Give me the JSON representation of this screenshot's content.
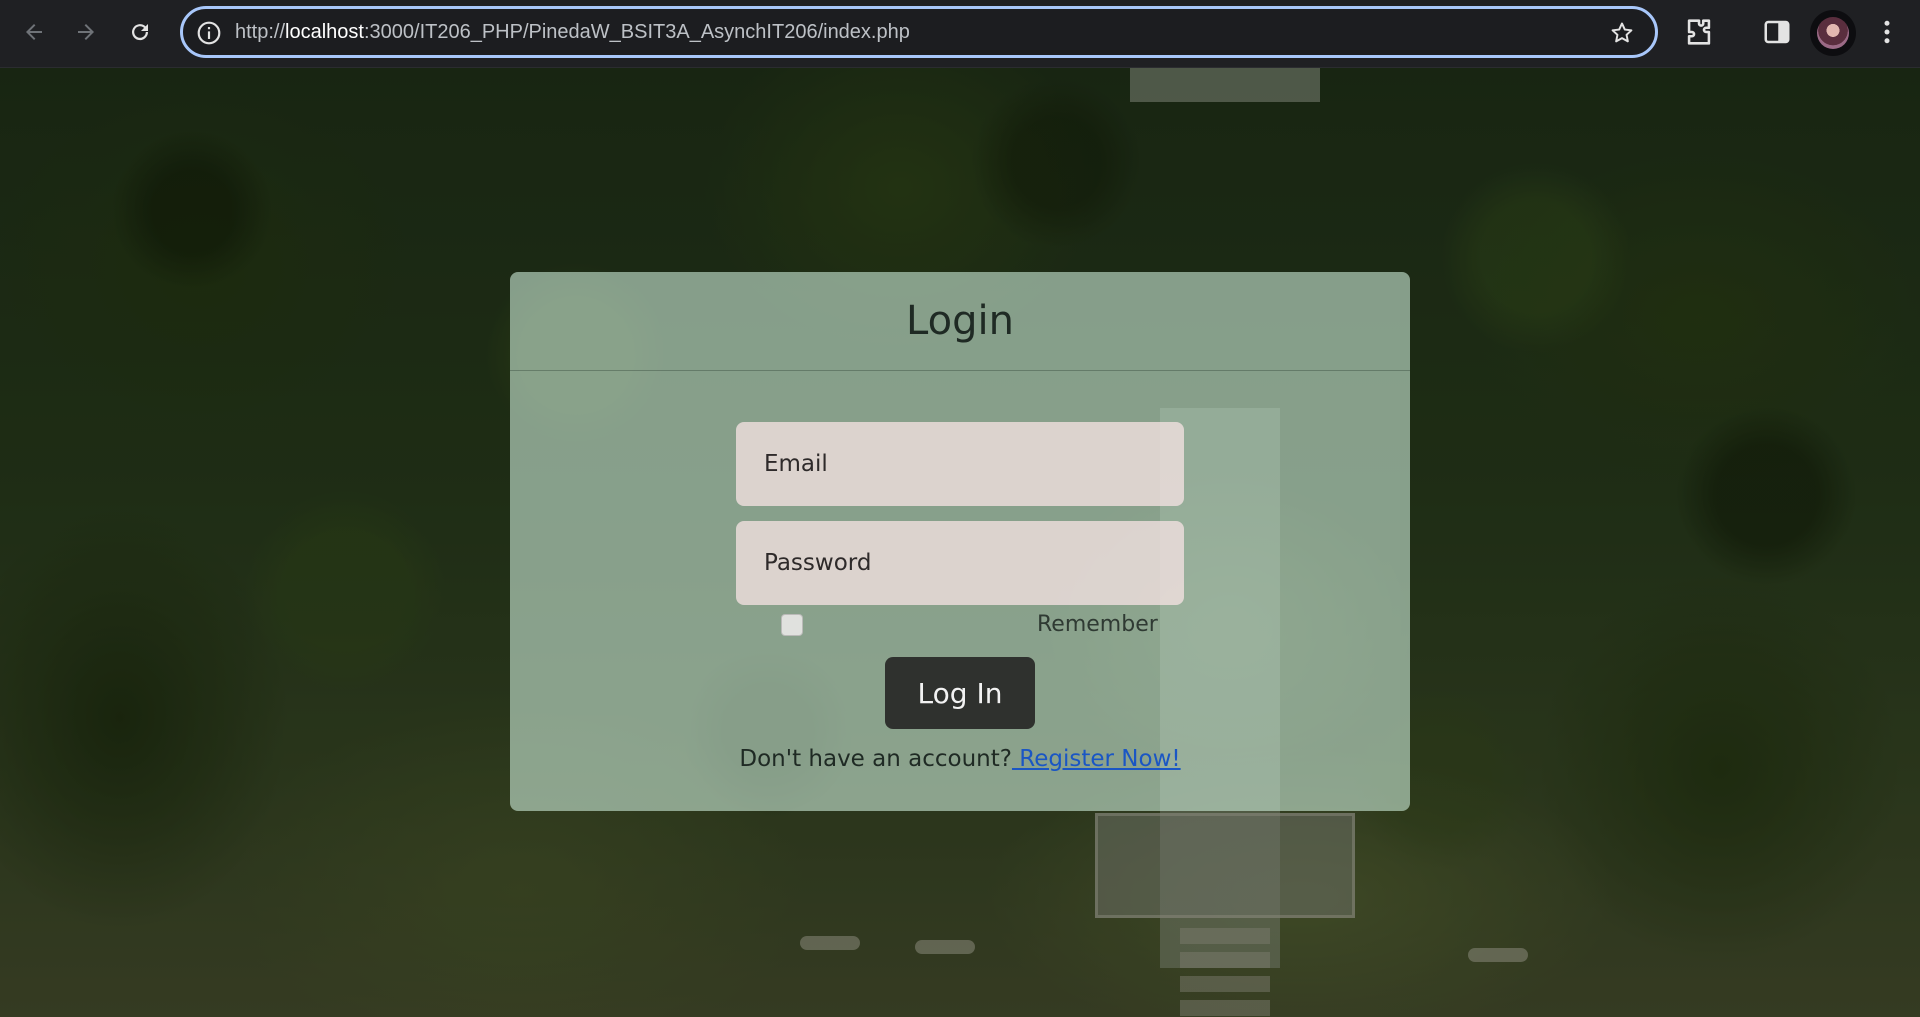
{
  "browser": {
    "url_prefix": "http://",
    "url_host": "localhost",
    "url_rest": ":3000/IT206_PHP/PinedaW_BSIT3A_AsynchIT206/index.php"
  },
  "icons": {
    "back": "arrow-left-icon",
    "forward": "arrow-right-icon",
    "reload": "reload-icon",
    "site_info": "info-icon",
    "bookmark": "star-icon",
    "extensions": "puzzle-icon",
    "side_panel": "side-panel-icon",
    "profile": "avatar",
    "menu": "kebab-menu-icon"
  },
  "colors": {
    "omnibox_focus": "#a8c7fa",
    "card_bg": "#c8e6d4",
    "button_bg": "#2f312e",
    "link": "#1a56c4"
  },
  "login": {
    "title": "Login",
    "email_placeholder": "Email",
    "password_placeholder": "Password",
    "remember_label": "Remember",
    "submit_label": "Log In",
    "register_prompt": "Don't have an account?",
    "register_link": " Register Now!"
  }
}
